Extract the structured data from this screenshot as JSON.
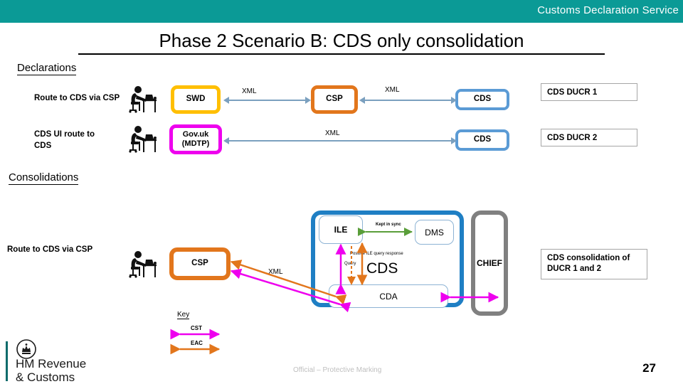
{
  "header": {
    "service_title": "Customs Declaration Service",
    "band_color": "#0b9a96"
  },
  "slide": {
    "title": "Phase 2 Scenario B: CDS only consolidation",
    "page_number": "27",
    "protective_marking": "Official – Protective Marking"
  },
  "sections": {
    "declarations": "Declarations",
    "consolidations": "Consolidations"
  },
  "declarations": {
    "rows": [
      {
        "label": "Route to CDS via CSP",
        "actor_icon": "person-at-desk-icon",
        "source_node": "SWD",
        "source_color": "#ffbf00",
        "mid_node": "CSP",
        "mid_color": "#e2761c",
        "link_label_1": "XML",
        "link_label_2": "XML",
        "target_node": "CDS",
        "target_color": "#5b9bd5",
        "callout": "CDS DUCR 1"
      },
      {
        "label": "CDS UI route to CDS",
        "actor_icon": "person-at-desk-icon",
        "source_node": "Gov.uk (MDTP)",
        "source_node_line1": "Gov.uk",
        "source_node_line2": "(MDTP)",
        "source_color": "#ee00ee",
        "link_label_1": "XML",
        "target_node": "CDS",
        "target_color": "#5b9bd5",
        "callout": "CDS DUCR 2"
      }
    ]
  },
  "consolidations": {
    "row_label": "Route to CDS via CSP",
    "actor_icon": "person-at-desk-icon",
    "csp_node": "CSP",
    "csp_color": "#e2761c",
    "xml_label": "XML",
    "cds_container": {
      "title": "CDS",
      "border_color": "#1f7fc4",
      "ile": "ILE",
      "dms": "DMS",
      "cda": "CDA",
      "kept_in_sync": "Kept in sync",
      "positive_response": "Positive ILE query response",
      "query": "Query"
    },
    "chief_node": "CHIEF",
    "chief_color": "#808080",
    "callout": "CDS consolidation of DUCR 1 and 2",
    "callout_line1": "CDS consolidation of",
    "callout_line2": "DUCR 1 and 2"
  },
  "key": {
    "title": "Key",
    "entries": [
      {
        "label": "CST",
        "color": "#ee00ee"
      },
      {
        "label": "EAC",
        "color": "#e2761c"
      }
    ]
  },
  "branding": {
    "org_line1": "HM Revenue",
    "org_line2": "& Customs",
    "crest_icon": "royal-crest-icon"
  }
}
